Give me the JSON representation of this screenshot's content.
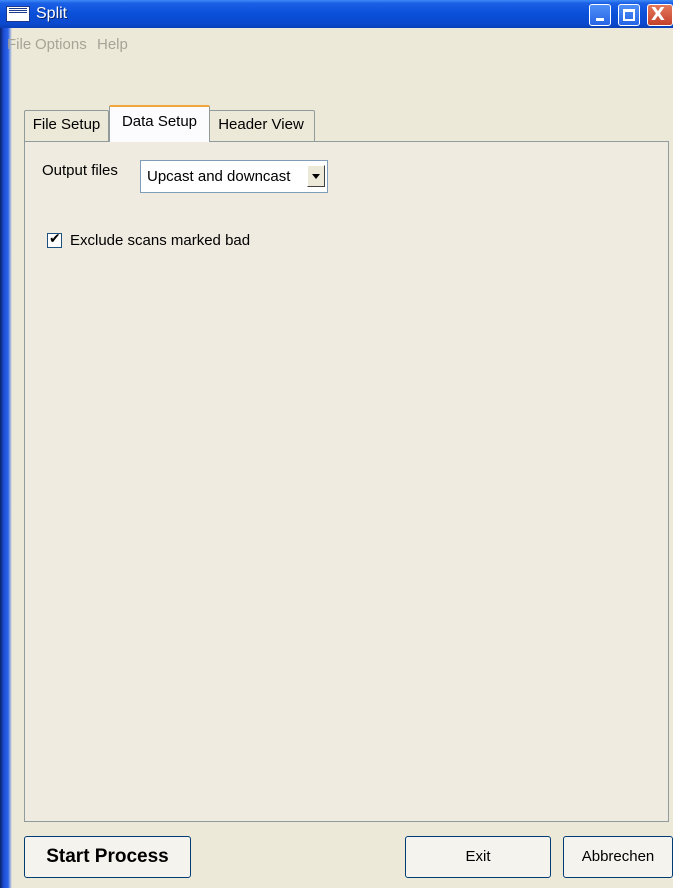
{
  "window": {
    "title": "Split",
    "app_icon": "app-icon",
    "controls": {
      "minimize_icon": "minimize-icon",
      "maximize_icon": "maximize-icon",
      "close_icon": "close-icon",
      "close_glyph": "X"
    }
  },
  "menu": {
    "items": [
      {
        "label": "File"
      },
      {
        "label": "Options"
      },
      {
        "label": "Help"
      }
    ]
  },
  "tabs": [
    {
      "label": "File Setup",
      "selected": false
    },
    {
      "label": "Data Setup",
      "selected": true
    },
    {
      "label": "Header View",
      "selected": false
    }
  ],
  "data_setup": {
    "output_files_label": "Output files",
    "output_files_value": "Upcast and downcast",
    "exclude_bad_label": "Exclude scans marked bad",
    "exclude_bad_checked": true,
    "check_glyph": "✔"
  },
  "buttons": {
    "start": "Start Process",
    "exit": "Exit",
    "cancel": "Abbrechen"
  },
  "colors": {
    "titlebar": "#0a4fd8",
    "window_face": "#ece9d8",
    "tab_highlight": "#f3a53d",
    "menu_disabled_text": "#a6a497"
  }
}
